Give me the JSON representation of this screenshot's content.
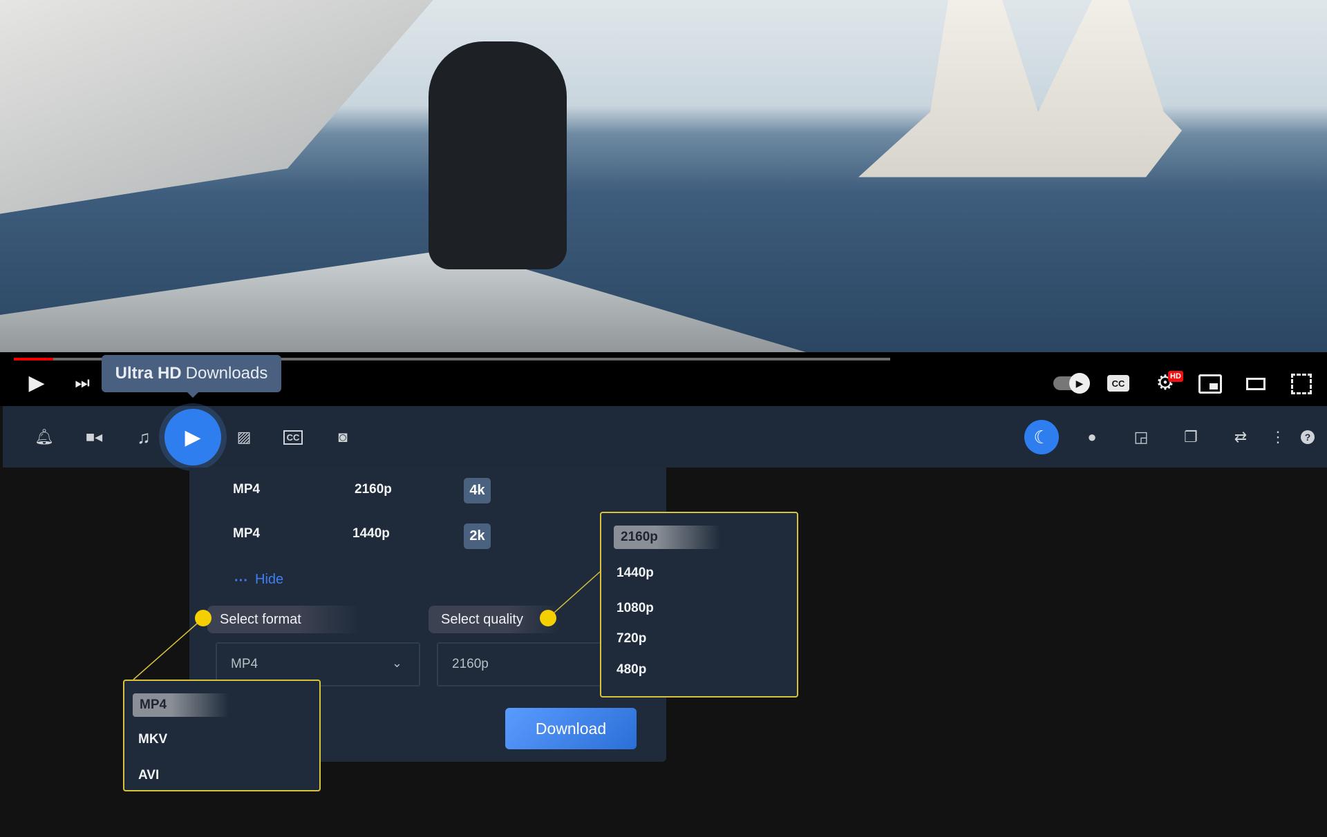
{
  "player": {
    "progress_percent": 4.5,
    "tooltip": {
      "bold": "Ultra HD",
      "rest": "Downloads"
    },
    "hd_badge": "HD",
    "colors": {
      "progress": "#ee0000",
      "accent": "#2f7ef0",
      "highlight": "#f5d000"
    }
  },
  "toolbar": {
    "left_icons": [
      "bell-icon",
      "video-camera-icon",
      "music-note-icon",
      "download-video-icon",
      "image-icon",
      "closed-captions-icon",
      "camera-icon"
    ],
    "right_icons": [
      "moon-icon",
      "lightbulb-icon",
      "picture-in-picture-icon",
      "copy-windows-icon",
      "repeat-icon",
      "more-vertical-icon",
      "help-icon"
    ]
  },
  "panel": {
    "rows": [
      {
        "format": "MP4",
        "quality": "2160p",
        "badge": "4k"
      },
      {
        "format": "MP4",
        "quality": "1440p",
        "badge": "2k"
      }
    ],
    "hide_label": "Hide",
    "select_format_label": "Select format",
    "select_quality_label": "Select quality",
    "format_value": "MP4",
    "quality_value": "2160p",
    "download_label": "Download",
    "format_options": [
      "MP4",
      "MKV",
      "AVI"
    ],
    "quality_options": [
      "2160p",
      "1440p",
      "1080p",
      "720p",
      "480p"
    ]
  }
}
